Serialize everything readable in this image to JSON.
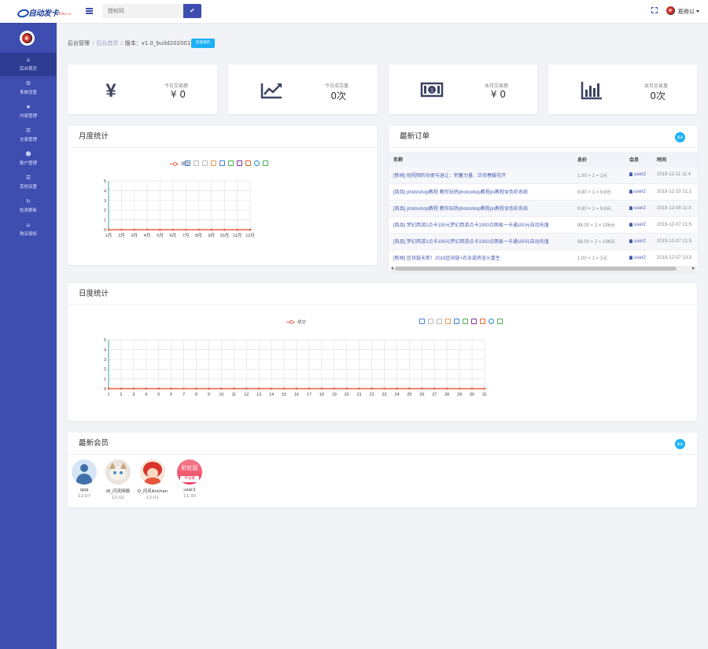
{
  "header": {
    "logo_text": "自动发卡",
    "logo_sub": "Elika.cn",
    "search_placeholder": "授权码",
    "user_name": "筋骨以"
  },
  "sidebar": {
    "items": [
      {
        "label": "后台首页",
        "icon": "home-icon",
        "active": true
      },
      {
        "label": "系统设置",
        "icon": "gear-icon"
      },
      {
        "label": "内容管理",
        "icon": "star-icon"
      },
      {
        "label": "交易管理",
        "icon": "list-icon"
      },
      {
        "label": "账户管理",
        "icon": "users-icon"
      },
      {
        "label": "其他设置",
        "icon": "list-icon"
      },
      {
        "label": "检测更新",
        "icon": "refresh-icon"
      },
      {
        "label": "购买授权",
        "icon": "home-icon"
      }
    ]
  },
  "breadcrumb": {
    "root": "后台管理",
    "current": "后台首页",
    "version": "版本：v1.0_build20200117",
    "check_update": "检查更新"
  },
  "stats": [
    {
      "label": "今日交易额",
      "value": "¥ 0",
      "icon": "yen-icon"
    },
    {
      "label": "今日成交量",
      "value": "0次",
      "icon": "trend-icon"
    },
    {
      "label": "本月交易额",
      "value": "¥ 0",
      "icon": "money-icon"
    },
    {
      "label": "本月交易量",
      "value": "0次",
      "icon": "bar-chart-icon"
    }
  ],
  "monthly": {
    "title": "月度统计",
    "chart_data": {
      "type": "line",
      "series": [
        {
          "name": "成交",
          "values": [
            0,
            0,
            0,
            0,
            0,
            0,
            0,
            0,
            0,
            0,
            0,
            0
          ]
        }
      ],
      "categories": [
        "1月",
        "2月",
        "3月",
        "4月",
        "5月",
        "6月",
        "7月",
        "8月",
        "9月",
        "10月",
        "11月",
        "12月"
      ],
      "ylim": [
        0,
        5
      ],
      "yticks": [
        "0",
        "1",
        "2",
        "3",
        "4",
        "5"
      ],
      "grid": true,
      "legend": "top"
    }
  },
  "orders": {
    "title": "最新订单",
    "more": "更多",
    "columns": [
      "名称",
      "总价",
      "会员",
      "时间"
    ],
    "rows": [
      {
        "name": "[新闻] 短视频的功使与退让：积蓄力量、正待春暖花开",
        "total": "1.00 × 1 = 1元",
        "user": "user2",
        "time": "2019-12-11 11:4"
      },
      {
        "name": "[商品] photoshop教程 教你玩转photoshop教程ps教程含色彩系统",
        "total": "9.80 × 1 = 9.8元",
        "user": "user2",
        "time": "2019-12-10 21:1"
      },
      {
        "name": "[商品] photoshop教程 教你玩转photoshop教程ps教程含色彩系统",
        "total": "9.80 × 1 = 9.8元",
        "user": "user2",
        "time": "2019-12-08 11:3"
      },
      {
        "name": "[商品] 梦幻西游2点卡100元梦幻西游点卡1000点网易一卡通100元自动充值",
        "total": "98.00 × 2 = 196元",
        "user": "user2",
        "time": "2019-12-07 21:5"
      },
      {
        "name": "[商品] 梦幻西游2点卡100元梦幻西游点卡1000点网易一卡通100元自动充值",
        "total": "98.00 × 2 = 196元",
        "user": "user2",
        "time": "2019-12-07 21:5"
      },
      {
        "name": "[新闻] 区块链未死！2019区块链+农业或将浴火重生",
        "total": "1.00 × 1 = 1元",
        "user": "user2",
        "time": "2019-12-07 13:3"
      }
    ]
  },
  "daily": {
    "title": "日度统计",
    "chart_data": {
      "type": "line",
      "series": [
        {
          "name": "成交",
          "values": [
            0,
            0,
            0,
            0,
            0,
            0,
            0,
            0,
            0,
            0,
            0,
            0,
            0,
            0,
            0,
            0,
            0,
            0,
            0,
            0,
            0,
            0,
            0,
            0,
            0,
            0,
            0,
            0,
            0,
            0,
            0
          ]
        }
      ],
      "categories": [
        "1",
        "2",
        "3",
        "4",
        "5",
        "6",
        "7",
        "8",
        "9",
        "10",
        "11",
        "12",
        "13",
        "14",
        "15",
        "16",
        "17",
        "18",
        "19",
        "20",
        "21",
        "22",
        "23",
        "24",
        "25",
        "26",
        "27",
        "28",
        "29",
        "30",
        "31"
      ],
      "ylim": [
        0,
        5
      ],
      "yticks": [
        "0",
        "1",
        "2",
        "3",
        "4",
        "5"
      ],
      "grid": true,
      "legend": "top"
    }
  },
  "members": {
    "title": "最新会员",
    "more": "更多",
    "list": [
      {
        "name": "qqq",
        "date": "12-07",
        "avatar": "default-user-icon"
      },
      {
        "name": "W_闪灵网络",
        "date": "12-02",
        "avatar": "cat-photo"
      },
      {
        "name": "Q_闪灵Anchen",
        "date": "12-01",
        "avatar": "cartoon-photo"
      },
      {
        "name": "user2",
        "date": "11-30",
        "avatar": "rainbow-badge",
        "badge_text": "彩虹屁",
        "badge_sub": "专号群"
      }
    ]
  },
  "colors": {
    "primary": "#3d4db0",
    "accent": "#1cb0f6",
    "series": "#e8644a"
  }
}
